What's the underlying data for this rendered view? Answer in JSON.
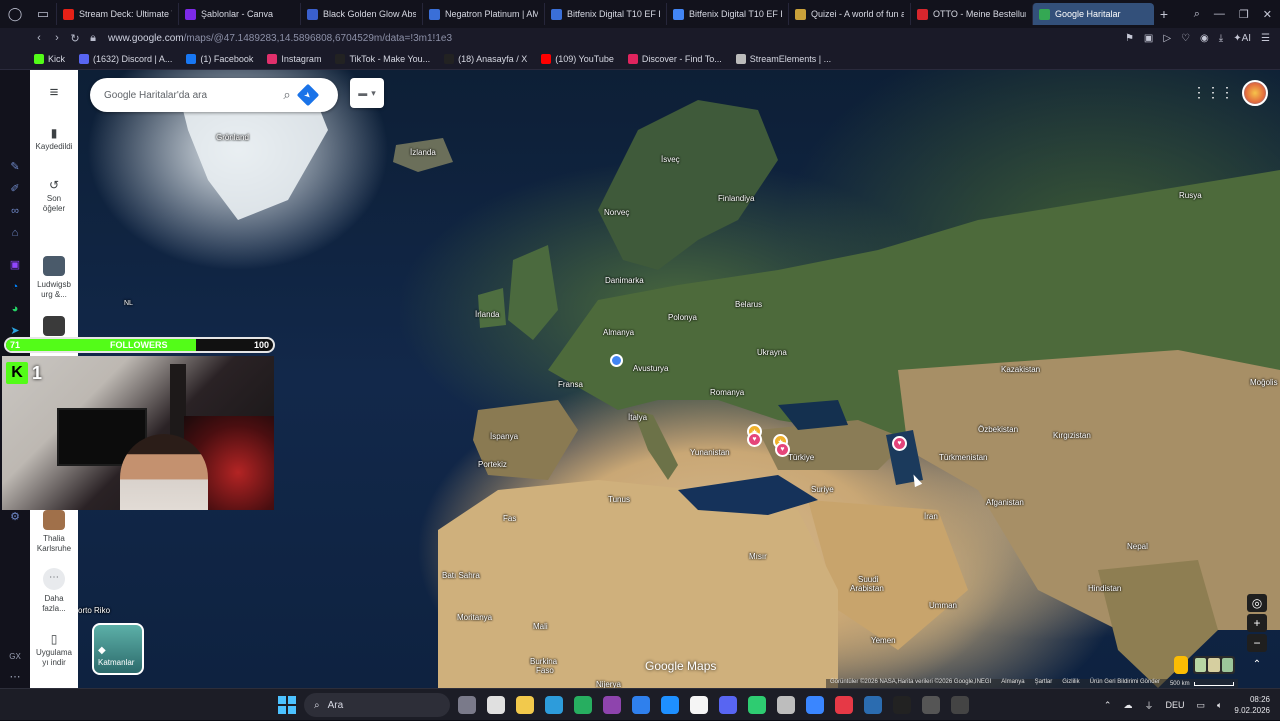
{
  "browser": {
    "tabs": [
      {
        "title": "Stream Deck: Ultimate Vi",
        "color": "#e62117"
      },
      {
        "title": "Şablonlar - Canva",
        "color": "#7d2ae8"
      },
      {
        "title": "Black Golden Glow Abst",
        "color": "#3a5fcd"
      },
      {
        "title": "Negatron Platinum | AME",
        "color": "#3a6fd8"
      },
      {
        "title": "Bitfenix Digital T10 EF Bla",
        "color": "#3a6fd8"
      },
      {
        "title": "Bitfenix Digital T10 EF Bla",
        "color": "#4285f4"
      },
      {
        "title": "Quizei - A world of fun a",
        "color": "#c9a13a"
      },
      {
        "title": "OTTO - Meine Bestellung",
        "color": "#d7262d"
      },
      {
        "title": "Google Haritalar",
        "color": "#34a853",
        "active": true
      }
    ],
    "url_host": "www.google.com",
    "url_path": "/maps/@47.1489283,14.5896808,6704529m/data=!3m1!1e3",
    "addr_ai_label": "AI",
    "bookmarks": [
      {
        "label": "Kick",
        "color": "#53fc18"
      },
      {
        "label": "(1632) Discord | A...",
        "color": "#5865f2"
      },
      {
        "label": "(1) Facebook",
        "color": "#1877f2"
      },
      {
        "label": "Instagram",
        "color": "#e1306c"
      },
      {
        "label": "TikTok - Make You...",
        "color": "#222222"
      },
      {
        "label": "(18) Anasayfa / X",
        "color": "#222222"
      },
      {
        "label": "(109) YouTube",
        "color": "#ff0000"
      },
      {
        "label": "Discover - Find To...",
        "color": "#e0245e"
      },
      {
        "label": "StreamElements | ...",
        "color": "#bbbbbb"
      }
    ]
  },
  "rail": {
    "saved": "Kaydedildi",
    "recents_l1": "Son",
    "recents_l2": "öğeler",
    "recent1_l1": "Ludwigsb",
    "recent1_l2": "urg &...",
    "recent2_l1": "Thalia",
    "recent2_l2": "Karlsruhe",
    "more_l1": "Daha",
    "more_l2": "fazla...",
    "app_l1": "Uygulama",
    "app_l2": "yı indir"
  },
  "search": {
    "placeholder": "Google Haritalar'da ara"
  },
  "map": {
    "labels": {
      "gronland": "Grönland",
      "izlanda": "İzlanda",
      "isvec": "İsveç",
      "finlandiya": "Finlandiya",
      "norvec": "Norveç",
      "rusya": "Rusya",
      "danimarka": "Danimarka",
      "belarus": "Belarus",
      "irlanda": "İrlanda",
      "almanya": "Almanya",
      "polonya": "Polonya",
      "nl": "NL",
      "ukrayna": "Ukrayna",
      "kazakistan": "Kazakistan",
      "mogolistan": "Moğolis",
      "fransa": "Fransa",
      "avusturya": "Avusturya",
      "romanya": "Romanya",
      "ozbekistan": "Özbekistan",
      "kirgizistan": "Kırgızistan",
      "ispanya": "İspanya",
      "italya": "İtalya",
      "yunanistan": "Yunanistan",
      "turkiye": "Türkiye",
      "turkmenistan": "Türkmenistan",
      "portekiz": "Portekiz",
      "suriye": "Suriye",
      "tunus": "Tunus",
      "afganistan": "Afganistan",
      "iran": "İran",
      "fas": "Fas",
      "misir": "Mısır",
      "nepal": "Nepal",
      "cezayir": "Batı Sahra",
      "suudi1": "Suudi",
      "suudi2": "Arabistan",
      "hindistan": "Hindistan",
      "porto_riko": "orto Riko",
      "umman": "Umman",
      "moritanya": "Moritanya",
      "mali": "Mali",
      "yemen": "Yemen",
      "burkina1": "Burkina",
      "burkina2": "Faso",
      "nijerya": "Nijerya"
    },
    "layers_label": "Katmanlar",
    "logo": "Google Maps",
    "attribution": "Görüntüler ©2026 NASA,Harita verileri ©2026 Google,INEGI",
    "attr_links": [
      "Almanya",
      "Şartlar",
      "Gizlilik",
      "Ürün Geri Bildirimi Gönder"
    ],
    "scale": "500 km"
  },
  "overlay": {
    "followers_current": "71",
    "followers_label": "FOLLOWERS",
    "followers_goal": "100",
    "followers_progress": 0.71,
    "kick_count": "1"
  },
  "taskbar": {
    "search_label": "Ara",
    "lang": "DEU",
    "time": "08:26",
    "date": "9.02.2026"
  }
}
